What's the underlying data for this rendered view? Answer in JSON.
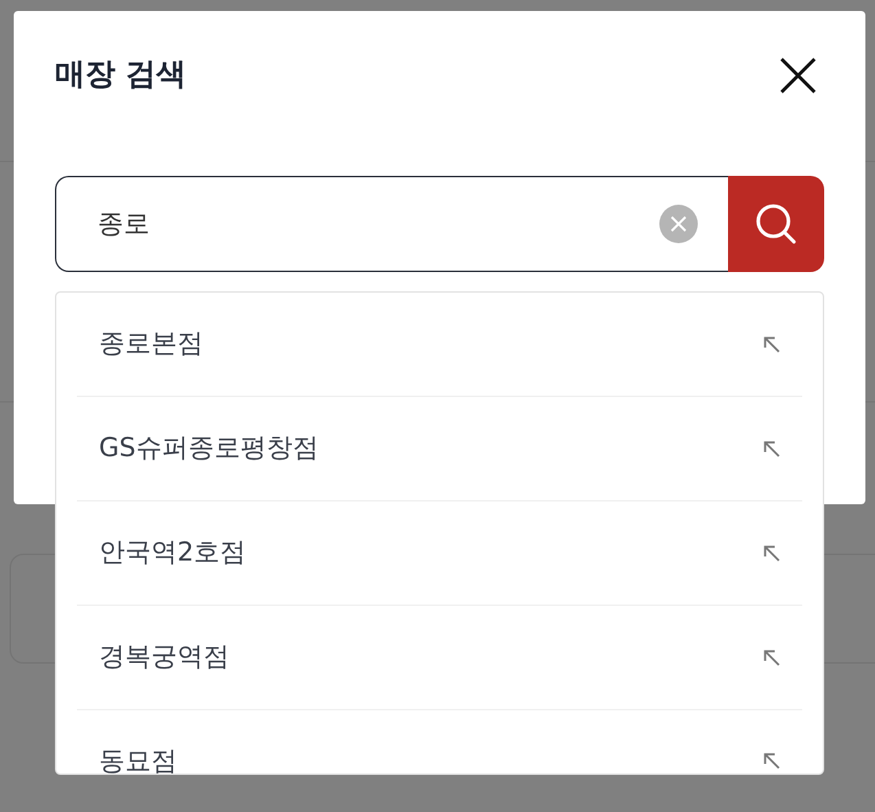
{
  "modal": {
    "title": "매장 검색"
  },
  "search": {
    "value": "종로"
  },
  "results": [
    {
      "name": "종로본점"
    },
    {
      "name": "GS슈퍼종로평창점"
    },
    {
      "name": "안국역2호점"
    },
    {
      "name": "경복궁역점"
    },
    {
      "name": "동묘점"
    }
  ]
}
